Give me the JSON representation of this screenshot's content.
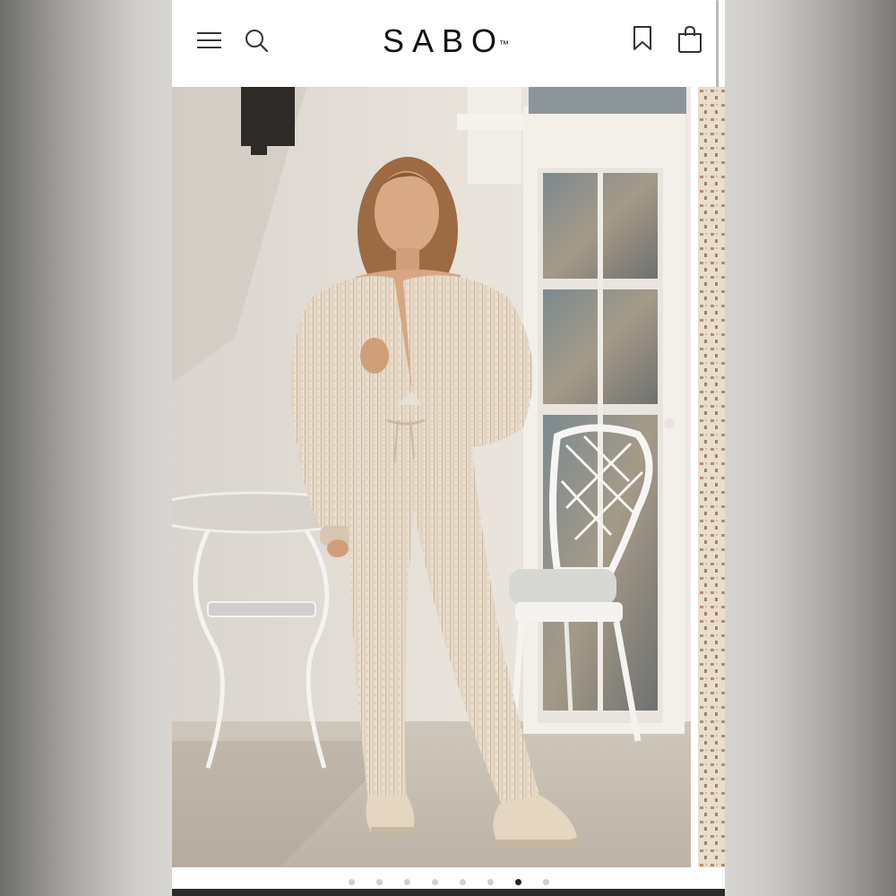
{
  "header": {
    "logo_text": "SABO",
    "logo_mark": "™",
    "icons": {
      "menu": "hamburger-menu-icon",
      "search": "search-icon",
      "bookmark": "bookmark-icon",
      "bag": "shopping-bag-icon"
    }
  },
  "carousel": {
    "slide_count": 8,
    "active_index": 6
  },
  "colors": {
    "text": "#111111",
    "background": "#ffffff",
    "dot_active": "#222222",
    "dot_inactive": "#cfcfcf"
  }
}
